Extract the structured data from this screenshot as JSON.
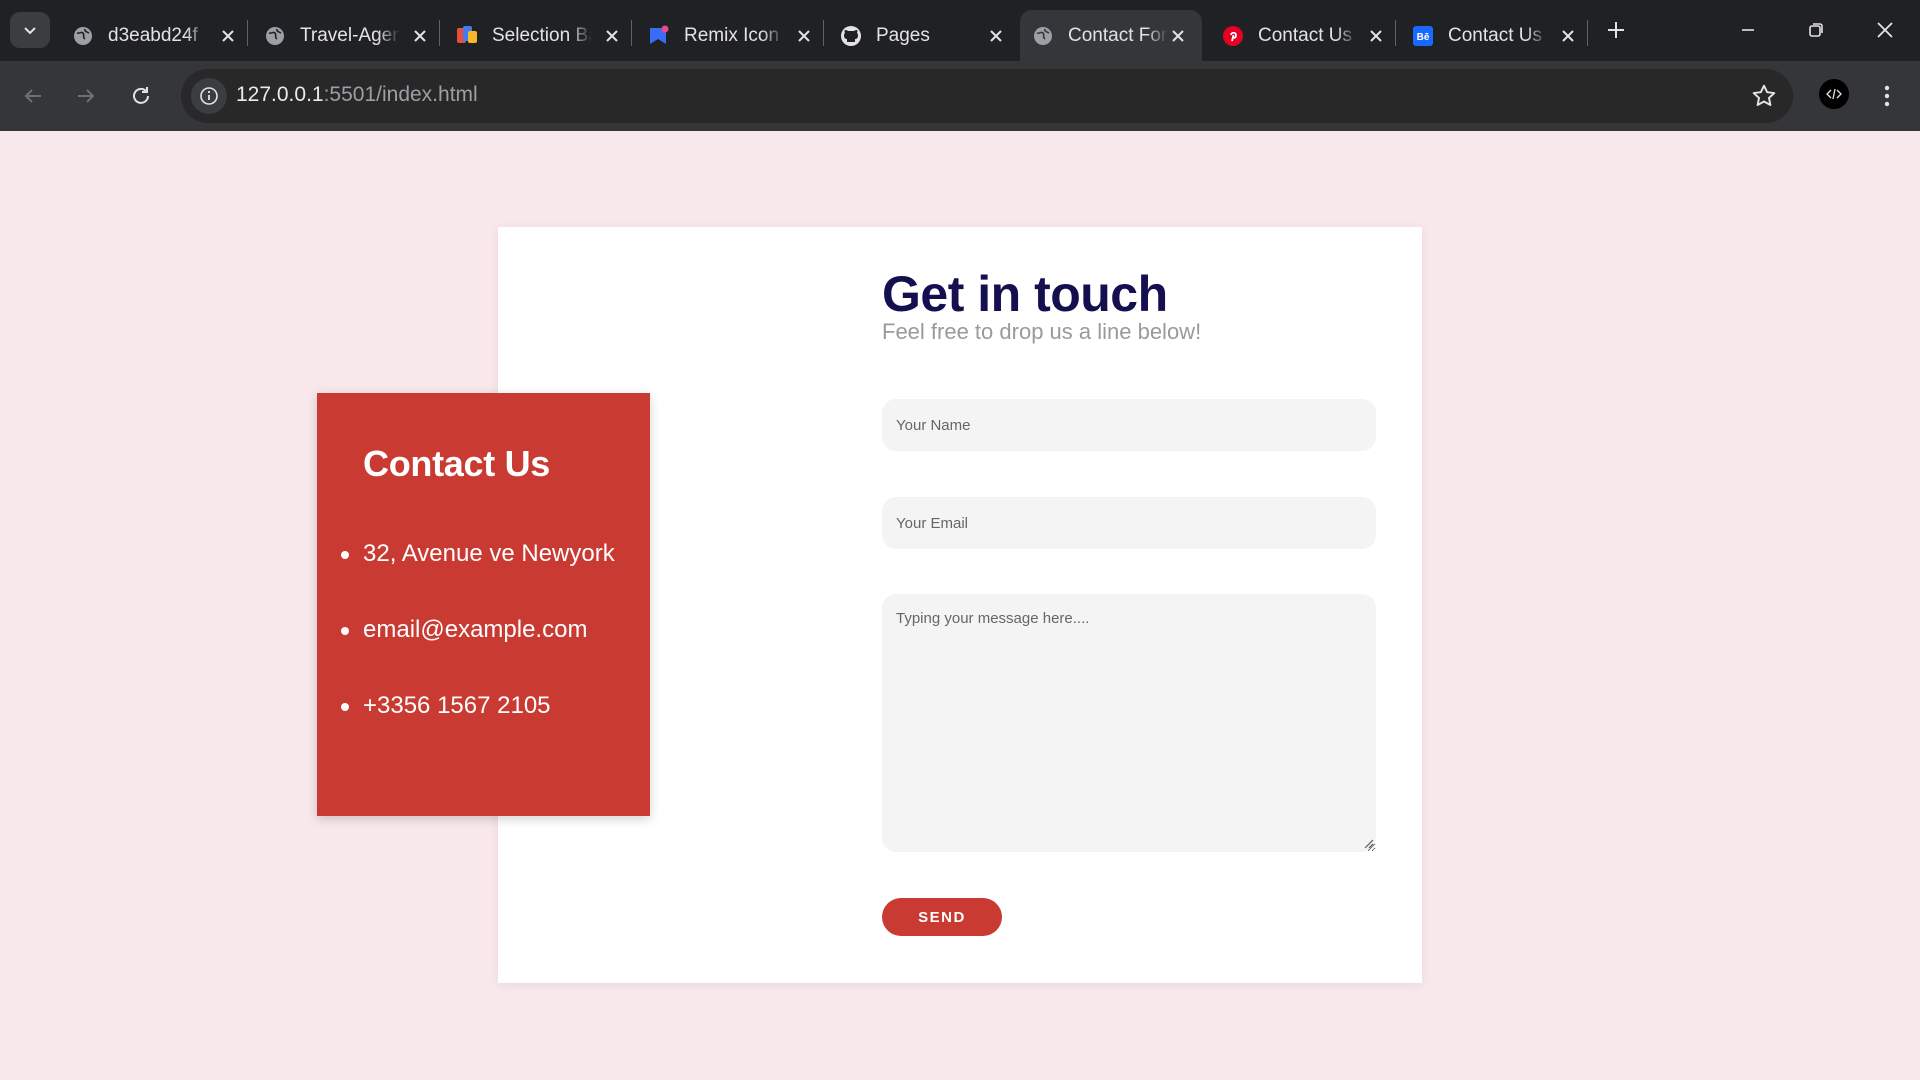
{
  "browser": {
    "tabs": [
      {
        "title": "d3eabd24f",
        "icon": "globe-icon"
      },
      {
        "title": "Travel-Agency",
        "icon": "globe-icon"
      },
      {
        "title": "Selection Bar",
        "icon": "selection-app-icon"
      },
      {
        "title": "Remix Icon",
        "icon": "remix-icon"
      },
      {
        "title": "Pages",
        "icon": "github-icon"
      },
      {
        "title": "Contact Form",
        "icon": "globe-icon",
        "active": true
      },
      {
        "title": "Contact Us",
        "icon": "pinterest-icon"
      },
      {
        "title": "Contact Us",
        "icon": "behance-icon"
      }
    ],
    "address": {
      "host": "127.0.0.1",
      "rest": ":5501/index.html"
    }
  },
  "contact": {
    "heading": "Contact Us",
    "items": [
      "32, Avenue ve Newyork",
      "email@example.com",
      "+3356 1567 2105"
    ]
  },
  "form": {
    "title": "Get in touch",
    "subtitle": "Feel free to drop us a line below!",
    "name_placeholder": "Your Name",
    "email_placeholder": "Your Email",
    "message_placeholder": "Typing your message here....",
    "send_label": "SEND"
  },
  "colors": {
    "accent": "#c93a32",
    "title": "#14104f",
    "background": "#f9e8eb"
  }
}
